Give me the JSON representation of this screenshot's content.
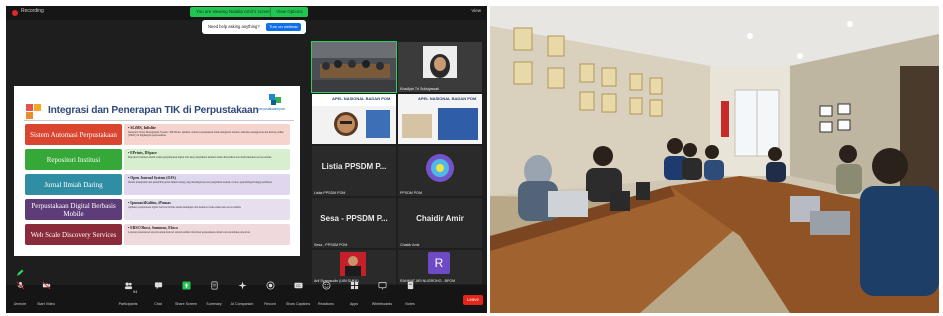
{
  "zoom": {
    "recording": "Recording",
    "sharing_banner": "You are viewing Natalia Amir's screen",
    "view_options": "View Options",
    "view": "View",
    "ask_prompt": "Need help asking anything?",
    "ask_button": "Turn on webinar"
  },
  "slide": {
    "title": "Integrasi dan Penerapan TIK di Perpustakaan",
    "logo_text": "perpustakaanbpom",
    "rows": [
      {
        "label": "Sistem Automasi Perpustakaan",
        "color": "#d9452f",
        "desc_bg": "#f6d3cd",
        "desc_head": "• SLiMS, Inlislite",
        "desc_text": "Senayan Library Management System / INLISLite: aplikasi otomasi perpustakaan untuk mengelola koleksi, sirkulasi, keanggotaan dan katalog online (OPAC) di lingkungan perpustakaan."
      },
      {
        "label": "Repositori Institusi",
        "color": "#35a838",
        "desc_bg": "#d7eecf",
        "desc_head": "• EPrints, DSpace",
        "desc_text": "Repositori institusi adalah wadah penyimpanan digital dari karya intelektual institusi untuk dilestarikan dan disebarluaskan secara terbuka."
      },
      {
        "label": "Jurnal Ilmiah Daring",
        "color": "#2f8ea3",
        "desc_bg": "#e0d6ee",
        "desc_head": "• Open Journal System (OJS)",
        "desc_text": "Sistem manajemen dan penerbitan jurnal ilmiah daring yang menangani proses pengiriman naskah, review, penyuntingan hingga publikasi."
      },
      {
        "label": "Perpustakaan Digital Berbasis Mobile",
        "color": "#5e3c78",
        "desc_bg": "#e7dfee",
        "desc_head": "• Ipusnas/iKaltim, iPusnas",
        "desc_text": "Aplikasi perpustakaan digital berbasis mobile untuk meminjam dan membaca buku elektronik secara mudah."
      },
      {
        "label": "Web Scale Discovery Services",
        "color": "#8a2b3a",
        "desc_bg": "#efd9dc",
        "desc_head": "• EBSCOhost, Summon, Ebsco",
        "desc_text": "Layanan penelusuran terpadu untuk mencari seluruh sumber informasi perpustakaan dalam satu antarmuka pencarian."
      }
    ]
  },
  "tiles": {
    "webinar_label": "APEL NASIONAL BADAN POM",
    "listia": "Listia PPSDM P...",
    "listia_caption": "Listia PPSDM POM",
    "ppsdm_caption": "PPSDM POM",
    "sesa": "Sesa - PPSDM P...",
    "sesa_caption": "Sesa - PPSDM POM",
    "chaidir": "Chaidir Amir",
    "chaidir_caption": "Chaidir Amir",
    "khadijah_caption": "Khadijah Tri Sulistyawati",
    "arif_caption": "Arif Syamsudin (UIN SUKA)",
    "r_initial": "R",
    "r_caption": "RAHMAT ARI NUGROHO - BPOM"
  },
  "toolbar": {
    "unmute": "Unmute",
    "start_video": "Start Video",
    "participants": "Participants",
    "participants_count": "94",
    "chat": "Chat",
    "share_screen": "Share Screen",
    "summary": "Summary",
    "ai_companion": "AI Companion",
    "record": "Record",
    "show_captions": "Show Captions",
    "reactions": "Reactions",
    "apps": "Apps",
    "whiteboards": "Whiteboards",
    "notes": "Notes",
    "leave": "Leave"
  }
}
